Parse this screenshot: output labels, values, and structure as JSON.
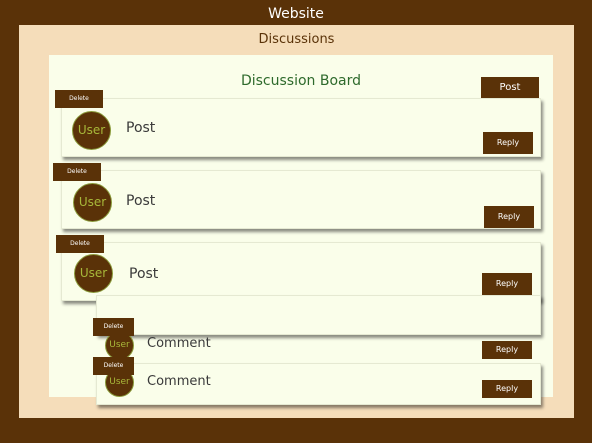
{
  "site": {
    "title": "Website"
  },
  "discussions": {
    "title": "Discussions"
  },
  "board": {
    "title": "Discussion Board",
    "post_button": "Post"
  },
  "posts": [
    {
      "delete": "Delete",
      "avatar": "User",
      "text": "Post",
      "reply": "Reply"
    },
    {
      "delete": "Delete",
      "avatar": "User",
      "text": "Post",
      "reply": "Reply"
    },
    {
      "delete": "Delete",
      "avatar": "User",
      "text": "Post",
      "reply": "Reply"
    }
  ],
  "comments": [
    {
      "delete": "Delete",
      "avatar": "User",
      "text": "Comment",
      "reply": "Reply"
    },
    {
      "delete": "Delete",
      "avatar": "User",
      "text": "Comment",
      "reply": "Reply"
    }
  ],
  "colors": {
    "outer_bg": "#5a3208",
    "discussions_bg": "#f5ddba",
    "board_bg": "#fafeea",
    "accent_brown": "#5a3208",
    "title_green": "#2e6a2c",
    "avatar_text": "#a8b83a"
  }
}
